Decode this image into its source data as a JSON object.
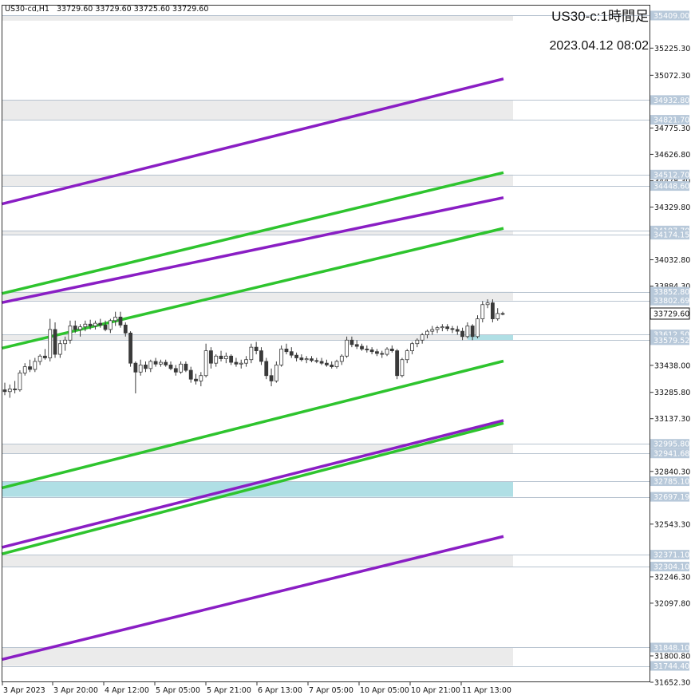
{
  "header": {
    "symbol": "US30-cd,H1",
    "ohlc": "33729.60 33729.60 33725.60 33729.60"
  },
  "title": "US30-c:1時間足",
  "timestamp": "2023.04.12 08:02",
  "chart_data": {
    "type": "candlestick",
    "ylim": [
      31652.3,
      35469.5
    ],
    "grid": false,
    "y_ticks": [
      "35225.30",
      "35072.30",
      "34775.30",
      "34626.80",
      "34478.30",
      "34329.80",
      "34032.80",
      "33884.30",
      "33438.00",
      "33285.80",
      "33137.30",
      "32840.30",
      "32543.30",
      "32246.30",
      "32097.80",
      "31800.80",
      "31652.30"
    ],
    "y_price_labels": [
      "35409.00",
      "34932.80",
      "34821.70",
      "34512.70",
      "34448.60",
      "34197.70",
      "34174.15",
      "33852.80",
      "33802.69",
      "33612.50",
      "33579.52",
      "32995.80",
      "32941.68",
      "32785.10",
      "32697.19",
      "32371.10",
      "32304.10",
      "31848.10",
      "31744.40"
    ],
    "current_price": "33729.60",
    "x_ticks": [
      "3 Apr 2023",
      "3 Apr 20:00",
      "4 Apr 12:00",
      "5 Apr 05:00",
      "5 Apr 21:00",
      "6 Apr 13:00",
      "7 Apr 05:00",
      "10 Apr 05:00",
      "10 Apr 21:00",
      "11 Apr 13:00"
    ],
    "zones": [
      {
        "top": 35409.0,
        "bottom": 35380.0,
        "fill": "#ebebeb"
      },
      {
        "top": 34932.8,
        "bottom": 34821.7,
        "fill": "#ebebeb"
      },
      {
        "top": 34512.7,
        "bottom": 34448.6,
        "fill": "#ebebeb"
      },
      {
        "top": 34197.7,
        "bottom": 34174.15,
        "fill": "#ebebeb"
      },
      {
        "top": 33852.8,
        "bottom": 33802.69,
        "fill": "#ebebeb"
      },
      {
        "top": 33612.5,
        "bottom": 33579.52,
        "fill": "#ebebeb"
      },
      {
        "top": 33612.5,
        "bottom": 33579.52,
        "fill": "#b0dfe5",
        "from_index": 92
      },
      {
        "top": 32995.8,
        "bottom": 32941.68,
        "fill": "#ebebeb"
      },
      {
        "top": 32785.1,
        "bottom": 32697.19,
        "fill": "#b0dfe5"
      },
      {
        "top": 32371.1,
        "bottom": 32304.1,
        "fill": "#ebebeb"
      },
      {
        "top": 31848.1,
        "bottom": 31744.4,
        "fill": "#ebebeb"
      }
    ],
    "trendlines": [
      {
        "color": "#8a1ec4",
        "start": 34347,
        "end": 35052
      },
      {
        "color": "#8a1ec4",
        "start": 33791,
        "end": 34383
      },
      {
        "color": "#8a1ec4",
        "start": 32412,
        "end": 33127
      },
      {
        "color": "#8a1ec4",
        "start": 31780,
        "end": 32474
      },
      {
        "color": "#2ec42e",
        "start": 33842,
        "end": 34524
      },
      {
        "color": "#2ec42e",
        "start": 33534,
        "end": 34210
      },
      {
        "color": "#2ec42e",
        "start": 32747,
        "end": 33462
      },
      {
        "color": "#2ec42e",
        "start": 32375,
        "end": 33112
      }
    ],
    "candles": [
      {
        "o": 33300,
        "h": 33340,
        "l": 33270,
        "c": 33290
      },
      {
        "o": 33290,
        "h": 33330,
        "l": 33255,
        "c": 33305
      },
      {
        "o": 33305,
        "h": 33350,
        "l": 33280,
        "c": 33300
      },
      {
        "o": 33300,
        "h": 33410,
        "l": 33290,
        "c": 33395
      },
      {
        "o": 33395,
        "h": 33450,
        "l": 33380,
        "c": 33430
      },
      {
        "o": 33430,
        "h": 33470,
        "l": 33400,
        "c": 33415
      },
      {
        "o": 33415,
        "h": 33480,
        "l": 33400,
        "c": 33460
      },
      {
        "o": 33460,
        "h": 33500,
        "l": 33440,
        "c": 33490
      },
      {
        "o": 33490,
        "h": 33530,
        "l": 33470,
        "c": 33480
      },
      {
        "o": 33480,
        "h": 33700,
        "l": 33460,
        "c": 33640
      },
      {
        "o": 33640,
        "h": 33680,
        "l": 33480,
        "c": 33500
      },
      {
        "o": 33500,
        "h": 33580,
        "l": 33480,
        "c": 33560
      },
      {
        "o": 33560,
        "h": 33600,
        "l": 33520,
        "c": 33580
      },
      {
        "o": 33580,
        "h": 33690,
        "l": 33560,
        "c": 33660
      },
      {
        "o": 33660,
        "h": 33690,
        "l": 33620,
        "c": 33640
      },
      {
        "o": 33640,
        "h": 33670,
        "l": 33600,
        "c": 33655
      },
      {
        "o": 33655,
        "h": 33690,
        "l": 33630,
        "c": 33670
      },
      {
        "o": 33670,
        "h": 33695,
        "l": 33640,
        "c": 33660
      },
      {
        "o": 33660,
        "h": 33690,
        "l": 33640,
        "c": 33675
      },
      {
        "o": 33675,
        "h": 33700,
        "l": 33650,
        "c": 33665
      },
      {
        "o": 33665,
        "h": 33690,
        "l": 33630,
        "c": 33640
      },
      {
        "o": 33640,
        "h": 33700,
        "l": 33620,
        "c": 33690
      },
      {
        "o": 33690,
        "h": 33740,
        "l": 33660,
        "c": 33710
      },
      {
        "o": 33710,
        "h": 33740,
        "l": 33650,
        "c": 33665
      },
      {
        "o": 33665,
        "h": 33680,
        "l": 33600,
        "c": 33620
      },
      {
        "o": 33620,
        "h": 33630,
        "l": 33430,
        "c": 33450
      },
      {
        "o": 33450,
        "h": 33460,
        "l": 33280,
        "c": 33400
      },
      {
        "o": 33400,
        "h": 33470,
        "l": 33380,
        "c": 33440
      },
      {
        "o": 33440,
        "h": 33460,
        "l": 33400,
        "c": 33420
      },
      {
        "o": 33420,
        "h": 33470,
        "l": 33400,
        "c": 33460
      },
      {
        "o": 33460,
        "h": 33480,
        "l": 33430,
        "c": 33445
      },
      {
        "o": 33445,
        "h": 33470,
        "l": 33430,
        "c": 33455
      },
      {
        "o": 33455,
        "h": 33470,
        "l": 33430,
        "c": 33440
      },
      {
        "o": 33440,
        "h": 33460,
        "l": 33410,
        "c": 33420
      },
      {
        "o": 33420,
        "h": 33440,
        "l": 33380,
        "c": 33400
      },
      {
        "o": 33400,
        "h": 33460,
        "l": 33390,
        "c": 33445
      },
      {
        "o": 33445,
        "h": 33460,
        "l": 33400,
        "c": 33410
      },
      {
        "o": 33410,
        "h": 33430,
        "l": 33340,
        "c": 33360
      },
      {
        "o": 33360,
        "h": 33390,
        "l": 33330,
        "c": 33350
      },
      {
        "o": 33350,
        "h": 33400,
        "l": 33320,
        "c": 33380
      },
      {
        "o": 33380,
        "h": 33560,
        "l": 33370,
        "c": 33520
      },
      {
        "o": 33520,
        "h": 33540,
        "l": 33420,
        "c": 33450
      },
      {
        "o": 33450,
        "h": 33500,
        "l": 33430,
        "c": 33490
      },
      {
        "o": 33490,
        "h": 33520,
        "l": 33460,
        "c": 33475
      },
      {
        "o": 33475,
        "h": 33510,
        "l": 33450,
        "c": 33490
      },
      {
        "o": 33490,
        "h": 33500,
        "l": 33440,
        "c": 33455
      },
      {
        "o": 33455,
        "h": 33480,
        "l": 33430,
        "c": 33445
      },
      {
        "o": 33445,
        "h": 33470,
        "l": 33420,
        "c": 33450
      },
      {
        "o": 33450,
        "h": 33490,
        "l": 33430,
        "c": 33470
      },
      {
        "o": 33470,
        "h": 33560,
        "l": 33450,
        "c": 33540
      },
      {
        "o": 33540,
        "h": 33570,
        "l": 33500,
        "c": 33520
      },
      {
        "o": 33520,
        "h": 33540,
        "l": 33440,
        "c": 33460
      },
      {
        "o": 33460,
        "h": 33480,
        "l": 33360,
        "c": 33380
      },
      {
        "o": 33380,
        "h": 33420,
        "l": 33320,
        "c": 33350
      },
      {
        "o": 33350,
        "h": 33460,
        "l": 33340,
        "c": 33440
      },
      {
        "o": 33440,
        "h": 33550,
        "l": 33430,
        "c": 33530
      },
      {
        "o": 33530,
        "h": 33560,
        "l": 33500,
        "c": 33515
      },
      {
        "o": 33515,
        "h": 33540,
        "l": 33480,
        "c": 33495
      },
      {
        "o": 33495,
        "h": 33510,
        "l": 33460,
        "c": 33480
      },
      {
        "o": 33480,
        "h": 33500,
        "l": 33460,
        "c": 33470
      },
      {
        "o": 33470,
        "h": 33490,
        "l": 33450,
        "c": 33475
      },
      {
        "o": 33475,
        "h": 33490,
        "l": 33455,
        "c": 33465
      },
      {
        "o": 33465,
        "h": 33480,
        "l": 33450,
        "c": 33460
      },
      {
        "o": 33460,
        "h": 33480,
        "l": 33440,
        "c": 33450
      },
      {
        "o": 33450,
        "h": 33470,
        "l": 33430,
        "c": 33440
      },
      {
        "o": 33440,
        "h": 33460,
        "l": 33420,
        "c": 33430
      },
      {
        "o": 33430,
        "h": 33470,
        "l": 33420,
        "c": 33460
      },
      {
        "o": 33460,
        "h": 33500,
        "l": 33440,
        "c": 33490
      },
      {
        "o": 33490,
        "h": 33600,
        "l": 33480,
        "c": 33580
      },
      {
        "o": 33580,
        "h": 33600,
        "l": 33540,
        "c": 33555
      },
      {
        "o": 33555,
        "h": 33580,
        "l": 33530,
        "c": 33545
      },
      {
        "o": 33545,
        "h": 33560,
        "l": 33520,
        "c": 33530
      },
      {
        "o": 33530,
        "h": 33550,
        "l": 33510,
        "c": 33525
      },
      {
        "o": 33525,
        "h": 33540,
        "l": 33500,
        "c": 33515
      },
      {
        "o": 33515,
        "h": 33530,
        "l": 33490,
        "c": 33505
      },
      {
        "o": 33505,
        "h": 33520,
        "l": 33480,
        "c": 33500
      },
      {
        "o": 33500,
        "h": 33540,
        "l": 33490,
        "c": 33530
      },
      {
        "o": 33530,
        "h": 33550,
        "l": 33510,
        "c": 33520
      },
      {
        "o": 33520,
        "h": 33530,
        "l": 33360,
        "c": 33380
      },
      {
        "o": 33380,
        "h": 33480,
        "l": 33370,
        "c": 33470
      },
      {
        "o": 33470,
        "h": 33530,
        "l": 33450,
        "c": 33520
      },
      {
        "o": 33520,
        "h": 33570,
        "l": 33500,
        "c": 33560
      },
      {
        "o": 33560,
        "h": 33590,
        "l": 33540,
        "c": 33580
      },
      {
        "o": 33580,
        "h": 33620,
        "l": 33560,
        "c": 33610
      },
      {
        "o": 33610,
        "h": 33640,
        "l": 33590,
        "c": 33630
      },
      {
        "o": 33630,
        "h": 33660,
        "l": 33610,
        "c": 33640
      },
      {
        "o": 33640,
        "h": 33660,
        "l": 33620,
        "c": 33650
      },
      {
        "o": 33650,
        "h": 33670,
        "l": 33630,
        "c": 33655
      },
      {
        "o": 33655,
        "h": 33670,
        "l": 33630,
        "c": 33645
      },
      {
        "o": 33645,
        "h": 33660,
        "l": 33620,
        "c": 33640
      },
      {
        "o": 33640,
        "h": 33660,
        "l": 33610,
        "c": 33630
      },
      {
        "o": 33630,
        "h": 33650,
        "l": 33580,
        "c": 33600
      },
      {
        "o": 33600,
        "h": 33680,
        "l": 33590,
        "c": 33660
      },
      {
        "o": 33660,
        "h": 33670,
        "l": 33580,
        "c": 33600
      },
      {
        "o": 33600,
        "h": 33720,
        "l": 33590,
        "c": 33700
      },
      {
        "o": 33700,
        "h": 33800,
        "l": 33680,
        "c": 33780
      },
      {
        "o": 33780,
        "h": 33810,
        "l": 33760,
        "c": 33790
      },
      {
        "o": 33790,
        "h": 33810,
        "l": 33680,
        "c": 33700
      },
      {
        "o": 33700,
        "h": 33760,
        "l": 33690,
        "c": 33730
      },
      {
        "o": 33730,
        "h": 33740,
        "l": 33720,
        "c": 33729.6
      }
    ]
  }
}
